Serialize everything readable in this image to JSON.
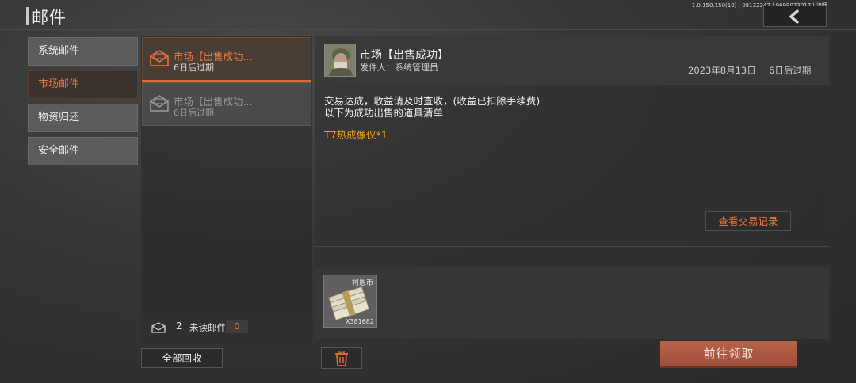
{
  "header": {
    "title": "邮件",
    "version": "1.0.150.150(10) | 08132347 | 9699073017 | 流畅",
    "back_icon": "chevron-left-icon"
  },
  "categories": [
    {
      "label": "系统邮件",
      "active": false
    },
    {
      "label": "市场邮件",
      "active": true
    },
    {
      "label": "物资归还",
      "active": false
    },
    {
      "label": "安全邮件",
      "active": false
    }
  ],
  "mail_list": [
    {
      "title": "市场【出售成功...",
      "expiry": "6日后过期",
      "active": true,
      "icon": "envelope-open-icon"
    },
    {
      "title": "市场【出售成功...",
      "expiry": "6日后过期",
      "active": false,
      "icon": "envelope-open-icon"
    }
  ],
  "unread": {
    "count": "2",
    "label": "未读邮件",
    "badge": "0",
    "icon": "envelope-icon"
  },
  "collect_all_label": "全部回收",
  "detail": {
    "subject": "市场【出售成功】",
    "sender": "发件人：系统管理员",
    "date": "2023年8月13日",
    "expiry": "6日后过期",
    "body_line1": "交易达成，收益请及时查收，(收益已扣除手续费)",
    "body_line2": "以下为成功出售的道具清单",
    "item_line": "T7热成像仪*1",
    "view_records_label": "查看交易记录"
  },
  "attachment": {
    "name": "柯恩币",
    "quantity": "X381682",
    "icon": "cash-stack-icon"
  },
  "delete_icon": "trash-icon",
  "claim_label": "前往领取",
  "colors": {
    "accent": "#ee7a3c",
    "item_highlight": "#f0a21e",
    "claim_button": "#a8553f"
  }
}
